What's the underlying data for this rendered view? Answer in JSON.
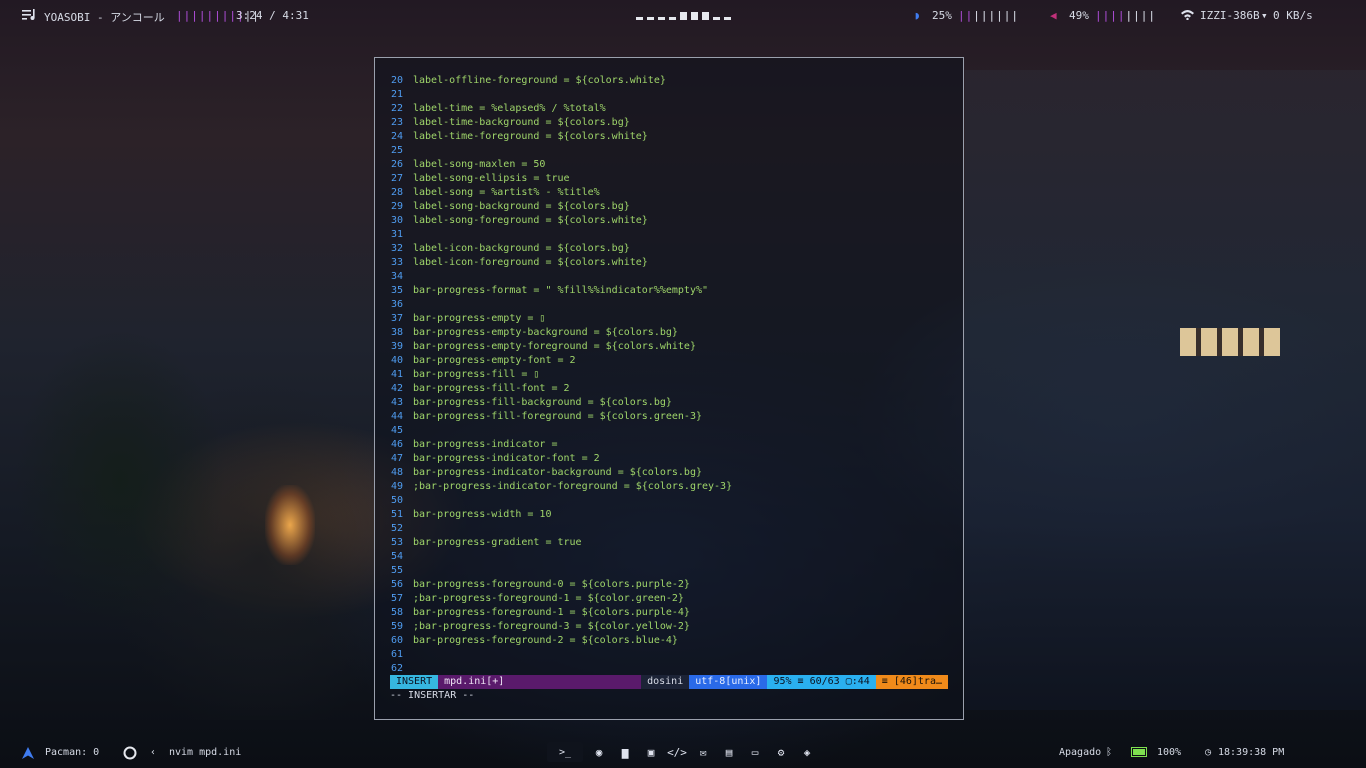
{
  "colors": {
    "accent_purple": "#b44fe0",
    "code_green": "#9fd56a",
    "line_number_blue": "#4f9cf0",
    "mode_cyan": "#36b7e0"
  },
  "topbar": {
    "music_icon": "music-icon",
    "song": "YOASOBI - アンコール",
    "song_bars": "|||||||||",
    "song_bars_white": "||",
    "time": "3:24 / 4:31",
    "brightness_icon": "moon-icon",
    "brightness": "25%",
    "brightness_bars": "||",
    "brightness_bars_white": "||||||",
    "volume_icon": "speaker-icon",
    "volume": "49%",
    "volume_bars": "||||",
    "volume_bars_white": "||||",
    "wifi_icon": "wifi-icon",
    "network": "IZZI-386B",
    "net_arrow": "▾",
    "net_speed": "0 KB/s"
  },
  "editor": {
    "lines": [
      {
        "n": "20",
        "t": "label-offline-foreground = ${colors.white}"
      },
      {
        "n": "21",
        "t": ""
      },
      {
        "n": "22",
        "t": "label-time = %elapsed% / %total%"
      },
      {
        "n": "23",
        "t": "label-time-background = ${colors.bg}"
      },
      {
        "n": "24",
        "t": "label-time-foreground = ${colors.white}"
      },
      {
        "n": "25",
        "t": ""
      },
      {
        "n": "26",
        "t": "label-song-maxlen = 50"
      },
      {
        "n": "27",
        "t": "label-song-ellipsis = true"
      },
      {
        "n": "28",
        "t": "label-song = %artist% - %title%"
      },
      {
        "n": "29",
        "t": "label-song-background = ${colors.bg}"
      },
      {
        "n": "30",
        "t": "label-song-foreground = ${colors.white}"
      },
      {
        "n": "31",
        "t": ""
      },
      {
        "n": "32",
        "t": "label-icon-background = ${colors.bg}"
      },
      {
        "n": "33",
        "t": "label-icon-foreground = ${colors.white}"
      },
      {
        "n": "34",
        "t": ""
      },
      {
        "n": "35",
        "t": "bar-progress-format = \" %fill%%indicator%%empty%\""
      },
      {
        "n": "36",
        "t": ""
      },
      {
        "n": "37",
        "t": "bar-progress-empty = ▯"
      },
      {
        "n": "38",
        "t": "bar-progress-empty-background = ${colors.bg}"
      },
      {
        "n": "39",
        "t": "bar-progress-empty-foreground = ${colors.white}"
      },
      {
        "n": "40",
        "t": "bar-progress-empty-font = 2"
      },
      {
        "n": "41",
        "t": "bar-progress-fill = ▯"
      },
      {
        "n": "42",
        "t": "bar-progress-fill-font = 2"
      },
      {
        "n": "43",
        "t": "bar-progress-fill-background = ${colors.bg}"
      },
      {
        "n": "44",
        "t": "bar-progress-fill-foreground = ${colors.green-3}"
      },
      {
        "n": "45",
        "t": ""
      },
      {
        "n": "46",
        "t": "bar-progress-indicator ="
      },
      {
        "n": "47",
        "t": "bar-progress-indicator-font = 2"
      },
      {
        "n": "48",
        "t": "bar-progress-indicator-background = ${colors.bg}"
      },
      {
        "n": "49",
        "t": ";bar-progress-indicator-foreground = ${colors.grey-3}"
      },
      {
        "n": "50",
        "t": ""
      },
      {
        "n": "51",
        "t": "bar-progress-width = 10"
      },
      {
        "n": "52",
        "t": ""
      },
      {
        "n": "53",
        "t": "bar-progress-gradient = true"
      },
      {
        "n": "54",
        "t": ""
      },
      {
        "n": "55",
        "t": ""
      },
      {
        "n": "56",
        "t": "bar-progress-foreground-0 = ${colors.purple-2}"
      },
      {
        "n": "57",
        "t": ";bar-progress-foreground-1 = ${color.green-2}"
      },
      {
        "n": "58",
        "t": "bar-progress-foreground-1 = ${colors.purple-4}"
      },
      {
        "n": "59",
        "t": ";bar-progress-foreground-3 = ${color.yellow-2}"
      },
      {
        "n": "60",
        "t": "bar-progress-foreground-2 = ${colors.blue-4}"
      },
      {
        "n": "61",
        "t": ""
      },
      {
        "n": "62",
        "t": ""
      }
    ],
    "status": {
      "mode": "INSERT",
      "file": "mpd.ini[+]",
      "filetype": "dosini",
      "encoding": "utf-8[unix]",
      "position": "95% ≡ 60/63 ▢:44",
      "warning": "≡ [46]tra…"
    },
    "cmdline": "-- INSERTAR --"
  },
  "bottombar": {
    "arch_icon": "arch-logo-icon",
    "pacman": "Pacman: 0",
    "circle_icon": "circle-icon",
    "back_icon": "chevron-left-icon",
    "window_title": "nvim mpd.ini",
    "dock": [
      {
        "icon": "terminal-icon",
        "glyph": ">_",
        "active": true
      },
      {
        "icon": "browser-icon",
        "glyph": "◉"
      },
      {
        "icon": "folder-icon",
        "glyph": "▆"
      },
      {
        "icon": "image-icon",
        "glyph": "▣"
      },
      {
        "icon": "code-icon",
        "glyph": "</>"
      },
      {
        "icon": "chat-icon",
        "glyph": "✉"
      },
      {
        "icon": "document-icon",
        "glyph": "▤"
      },
      {
        "icon": "monitor-icon",
        "glyph": "▭"
      },
      {
        "icon": "settings-icon",
        "glyph": "⚙"
      },
      {
        "icon": "gamepad-icon",
        "glyph": "◈"
      }
    ],
    "bluetooth_label": "Apagado",
    "bluetooth_icon": "bluetooth-icon",
    "battery_icon": "battery-icon",
    "battery": "100%",
    "battery_level": 1.0,
    "clock_icon": "clock-icon",
    "clock": "18:39:38 PM"
  }
}
